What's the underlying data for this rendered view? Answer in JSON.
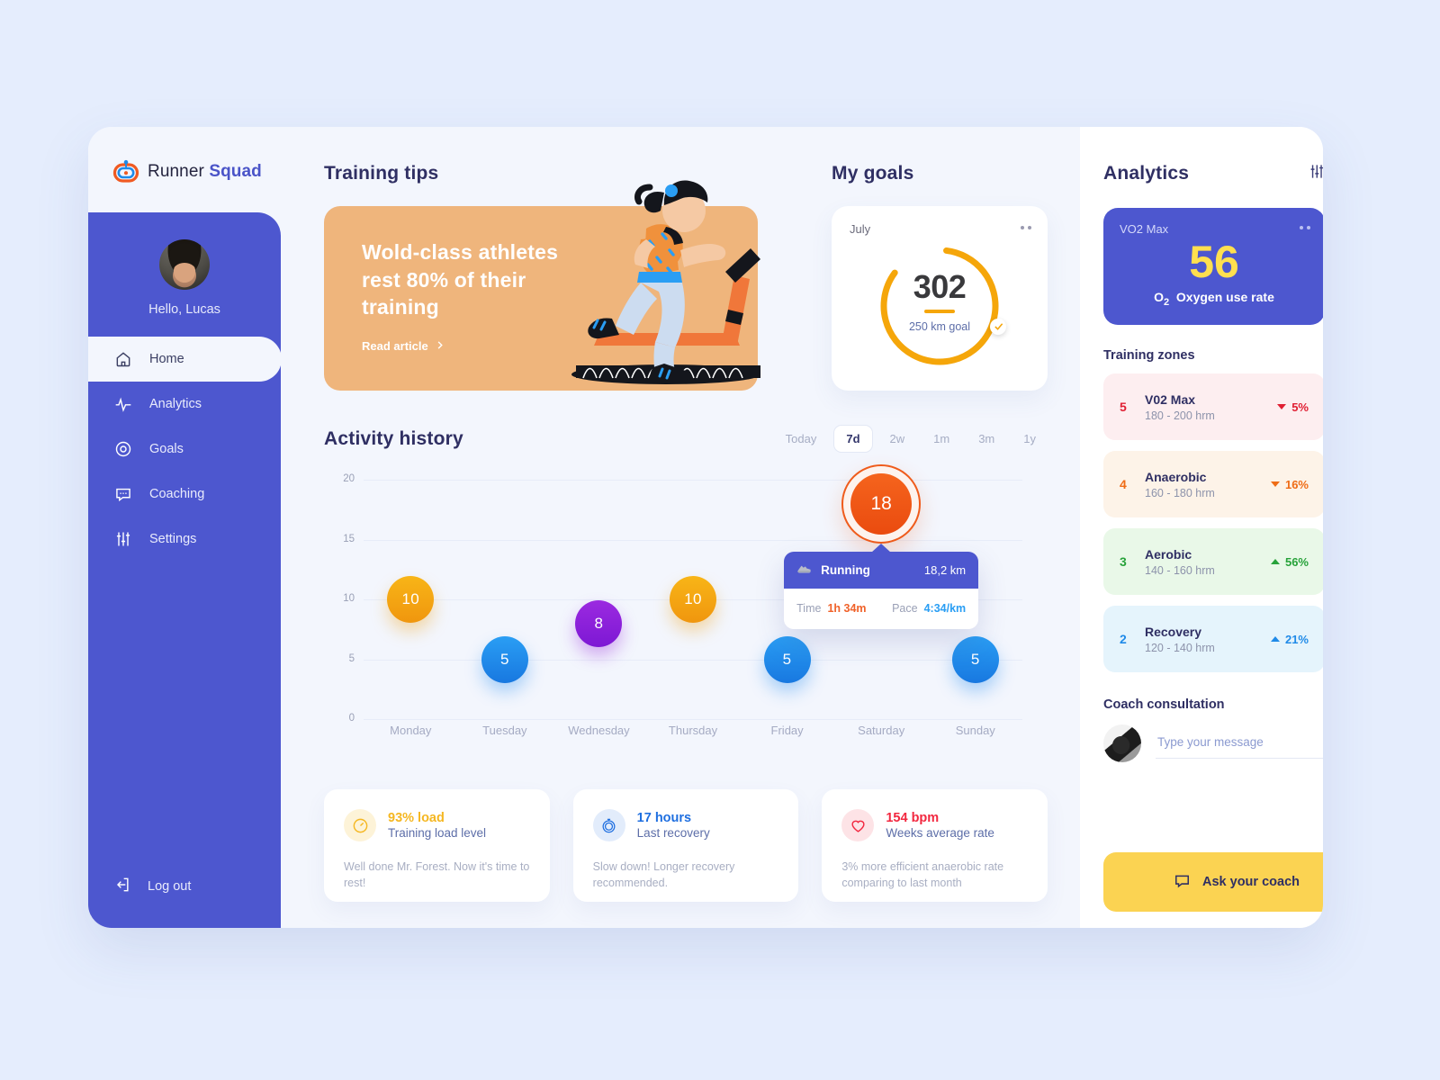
{
  "brand": {
    "name_light": "Runner",
    "name_bold": "Squad",
    "logo_icon": "runner-squad-logo"
  },
  "sidebar": {
    "greeting": "Hello, Lucas",
    "items": [
      {
        "label": "Home",
        "icon": "home-icon",
        "active": true
      },
      {
        "label": "Analytics",
        "icon": "pulse-icon",
        "active": false
      },
      {
        "label": "Goals",
        "icon": "target-icon",
        "active": false
      },
      {
        "label": "Coaching",
        "icon": "chat-icon",
        "active": false
      },
      {
        "label": "Settings",
        "icon": "sliders-icon",
        "active": false
      }
    ],
    "logout": {
      "label": "Log out",
      "icon": "logout-icon"
    }
  },
  "training_tips": {
    "title": "Training tips",
    "banner_text": "Wold-class athletes rest 80% of their training",
    "link": "Read article",
    "link_icon": "chevron-right-icon",
    "bg_color": "#efb57c"
  },
  "my_goals": {
    "title": "My goals",
    "month": "July",
    "menu_icon": "more-dots-icon",
    "value": "302",
    "subtitle": "250 km goal",
    "check_icon": "check-icon",
    "accent": "#f5a60a",
    "progress_percent": 83
  },
  "activity": {
    "title": "Activity history",
    "ranges": [
      {
        "label": "Today",
        "active": false
      },
      {
        "label": "7d",
        "active": true
      },
      {
        "label": "2w",
        "active": false
      },
      {
        "label": "1m",
        "active": false
      },
      {
        "label": "3m",
        "active": false
      },
      {
        "label": "1y",
        "active": false
      }
    ]
  },
  "chart_data": {
    "type": "scatter",
    "title": "Activity history",
    "xlabel": "",
    "ylabel": "",
    "ylim": [
      0,
      20
    ],
    "yticks": [
      0,
      5,
      10,
      15,
      20
    ],
    "grid": true,
    "legend": "none",
    "categories": [
      "Monday",
      "Tuesday",
      "Wednesday",
      "Thursday",
      "Friday",
      "Saturday",
      "Sunday"
    ],
    "values": [
      10,
      5,
      8,
      10,
      5,
      18,
      5
    ],
    "point_colors": [
      "#f5a60a",
      "#1f8ae8",
      "#8c20d8",
      "#f5a60a",
      "#1f8ae8",
      "#ef5b1b",
      "#1f8ae8"
    ],
    "selected_index": 5
  },
  "tooltip": {
    "icon": "running-shoe-icon",
    "activity": "Running",
    "distance": "18,2 km",
    "time_label": "Time",
    "time_value": "1h 34m",
    "pace_label": "Pace",
    "pace_value": "4:34/km"
  },
  "stats": [
    {
      "icon": "gauge-icon",
      "icon_bg": "#fdf3d8",
      "icon_color": "#f5b721",
      "value": "93% load",
      "value_color": "#f5b721",
      "subtitle": "Training load level",
      "description": "Well done Mr. Forest. Now it's time to rest!"
    },
    {
      "icon": "recovery-icon",
      "icon_bg": "#e2ecfb",
      "icon_color": "#1f6fe0",
      "value": "17 hours",
      "value_color": "#1f6fe0",
      "subtitle": "Last recovery",
      "description": "Slow down! Longer recovery recommended."
    },
    {
      "icon": "heart-icon",
      "icon_bg": "#fde3e6",
      "icon_color": "#f2273f",
      "value": "154 bpm",
      "value_color": "#f2273f",
      "subtitle": "Weeks average rate",
      "description": "3% more efficient  anaerobic rate comparing to last month"
    }
  ],
  "analytics": {
    "title": "Analytics",
    "filter_icon": "sliders-icon",
    "vo2": {
      "label": "VO2 Max",
      "menu_icon": "more-dots-icon",
      "value": "56",
      "o2": "O",
      "o2_sub": "2",
      "rate_label": "Oxygen use rate",
      "bg": "#4d57cf",
      "value_color": "#ffdf4f"
    },
    "zones_title": "Training zones",
    "zones": [
      {
        "num": "5",
        "name": "V02 Max",
        "range": "180 - 200 hrm",
        "pct": "5%",
        "dir": "down",
        "bg": "#fdeef0",
        "num_color": "#e01f33",
        "pct_color": "#e01f33"
      },
      {
        "num": "4",
        "name": "Anaerobic",
        "range": "160 - 180 hrm",
        "pct": "16%",
        "dir": "down",
        "bg": "#fdf3e8",
        "num_color": "#ef6c16",
        "pct_color": "#ef6c16"
      },
      {
        "num": "3",
        "name": "Aerobic",
        "range": "140 - 160 hrm",
        "pct": "56%",
        "dir": "up",
        "bg": "#e9f8e8",
        "num_color": "#27a23a",
        "pct_color": "#27a23a"
      },
      {
        "num": "2",
        "name": "Recovery",
        "range": "120 - 140 hrm",
        "pct": "21%",
        "dir": "up",
        "bg": "#e5f4fc",
        "num_color": "#1f8ae8",
        "pct_color": "#1f8ae8"
      }
    ],
    "coach_title": "Coach consultation",
    "message_placeholder": "Type your message",
    "message_value": "",
    "ask_button": "Ask your coach",
    "ask_button_icon": "chat-icon",
    "ask_button_bg": "#fbd352"
  }
}
